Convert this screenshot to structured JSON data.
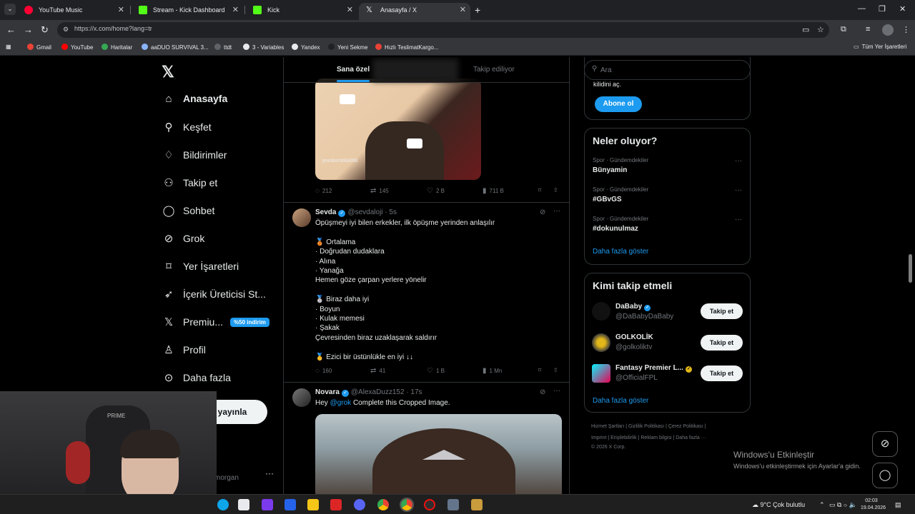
{
  "browser": {
    "tabs": [
      {
        "title": "YouTube Music",
        "color": "#ff0033"
      },
      {
        "title": "Stream - Kick Dashboard",
        "color": "#53fc18"
      },
      {
        "title": "Kick",
        "color": "#53fc18"
      },
      {
        "title": "Anasayfa / X",
        "color": "#ffffff"
      }
    ],
    "url": "https://x.com/home?lang=tr",
    "bookmarks": [
      "Gmail",
      "YouTube",
      "Haritalar",
      "aaDUO SURVIVAL 3...",
      "ttdt",
      "3 - Variables",
      "Yandex",
      "Yeni Sekme",
      "Hızlı TeslimatKargo..."
    ],
    "all_bookmarks": "Tüm Yer İşaretleri"
  },
  "sidebar": {
    "items": [
      {
        "label": "Anasayfa",
        "icon": "home-icon",
        "glyph": "⌂"
      },
      {
        "label": "Keşfet",
        "icon": "search-icon",
        "glyph": "⚲"
      },
      {
        "label": "Bildirimler",
        "icon": "bell-icon",
        "glyph": "🔔"
      },
      {
        "label": "Takip et",
        "icon": "add-person-icon",
        "glyph": "👤"
      },
      {
        "label": "Sohbet",
        "icon": "chat-icon",
        "glyph": "◯"
      },
      {
        "label": "Grok",
        "icon": "grok-icon",
        "glyph": "◌"
      },
      {
        "label": "Yer İşaretleri",
        "icon": "bookmark-icon",
        "glyph": "🔖"
      },
      {
        "label": "İçerik Üreticisi St...",
        "icon": "rocket-icon",
        "glyph": "🚀"
      },
      {
        "label": "Premiu...",
        "icon": "x-premium-icon",
        "glyph": "𝕏"
      },
      {
        "label": "Profil",
        "icon": "profile-icon",
        "glyph": "👤"
      },
      {
        "label": "Daha fazla",
        "icon": "more-icon",
        "glyph": "⋯"
      }
    ],
    "premium_badge": "%50 indirim",
    "post_label": "yayınla",
    "account_name": "morgan",
    "more_dots": "···"
  },
  "feed": {
    "tab_for_you": "Sana özel",
    "tab_following": "Takip ediliyor",
    "post1": {
      "watermark": "jeanbombila666",
      "replies": "212",
      "reposts": "145",
      "likes": "2 B",
      "views": "711 B"
    },
    "post2": {
      "name": "Sevda",
      "handle": "@sevdaloji",
      "time": "· 5s",
      "body": "Öpüşmeyi iyi bilen erkekler, ilk öpüşme yerinden anlaşılır\n\n🥉 Ortalama\n· Doğrudan dudaklara\n· Alına\n· Yanağa\nHemen göze çarpan yerlere yönelir\n\n🥈 Biraz daha iyi\n· Boyun\n· Kulak memesi\n· Şakak\nÇevresinden biraz uzaklaşarak saldırır\n\n🥇 Ezici bir üstünlükle en iyi ↓↓",
      "replies": "160",
      "reposts": "41",
      "likes": "1 B",
      "views": "1 Mn"
    },
    "post3": {
      "name": "Novara",
      "handle": "@AlexaDuzz152",
      "time": "· 17s",
      "body_prefix": "Hey ",
      "mention": "@grok",
      "body_suffix": " Complete this Cropped Image."
    }
  },
  "right": {
    "search_placeholder": "Ara",
    "premium_cut_text": "kilidini aç.",
    "subscribe": "Abone ol",
    "trends_title": "Neler oluyor?",
    "trends": [
      {
        "meta": "Spor · Gündemdekiler",
        "name": "Bünyamin"
      },
      {
        "meta": "Spor · Gündemdekiler",
        "name": "#GBvGS"
      },
      {
        "meta": "Spor · Gündemdekiler",
        "name": "#dokunulmaz"
      }
    ],
    "show_more": "Daha fazla göster",
    "wtf_title": "Kimi takip etmeli",
    "wtf": [
      {
        "name": "DaBaby",
        "handle": "@DaBabyDaBaby",
        "badge": "blue"
      },
      {
        "name": "GOLKOLİK",
        "handle": "@golkoliktv",
        "badge": "none"
      },
      {
        "name": "Fantasy Premier L...",
        "handle": "@OfficialFPL",
        "badge": "gold"
      }
    ],
    "follow": "Takip et",
    "wtf_show_more": "Daha fazla göster",
    "footer1": "Hizmet Şartları  |  Gizlilik Politikası  |  Çerez Politikası  |",
    "footer2": "Imprint  |  Erişilebilirlik  |  Reklam bilgisi  |  Daha fazla ···",
    "footer3": "© 2026 X Corp."
  },
  "windows": {
    "activate_title": "Windows'u Etkinleştir",
    "activate_sub": "Windows'u etkinleştirmek için Ayarlar'a gidin.",
    "weather": "9°C  Çok bulutlu",
    "time": "02:03",
    "date": "19.04.2026"
  },
  "webcam": {
    "chair_brand": "PRIME"
  }
}
